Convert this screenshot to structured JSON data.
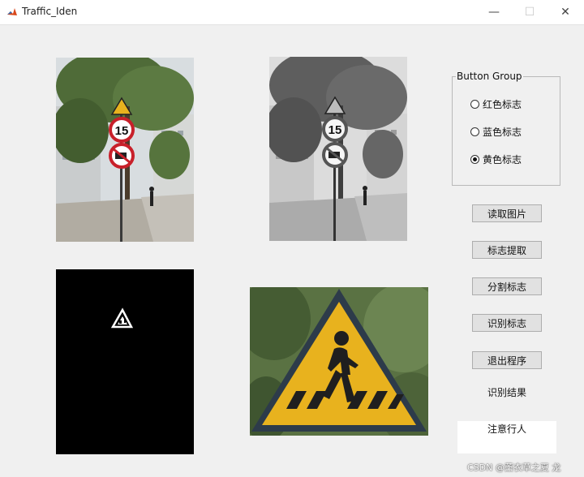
{
  "window": {
    "title": "Traffic_Iden",
    "minimize_glyph": "—",
    "maximize_glyph": "☐",
    "close_glyph": "✕"
  },
  "button_group": {
    "title": "Button Group",
    "options": [
      {
        "label": "红色标志",
        "selected": false
      },
      {
        "label": "蓝色标志",
        "selected": false
      },
      {
        "label": "黄色标志",
        "selected": true
      }
    ]
  },
  "buttons": {
    "read_image": "读取图片",
    "extract_sign": "标志提取",
    "segment_sign": "分割标志",
    "identify_sign": "识别标志",
    "exit_program": "退出程序"
  },
  "result": {
    "label": "识别结果",
    "value": "注意行人"
  },
  "sign_panel_texts": {
    "speed_limit": "15"
  },
  "watermark": "CSDN @薰衣草之夏 龙",
  "icons": {
    "app": "matlab-icon",
    "pedestrian": "pedestrian-icon",
    "no-horn": "no-horn-icon"
  },
  "colors": {
    "sign_yellow": "#e8b21e",
    "sign_red": "#c8202a",
    "foliage": "#4f6b38"
  }
}
